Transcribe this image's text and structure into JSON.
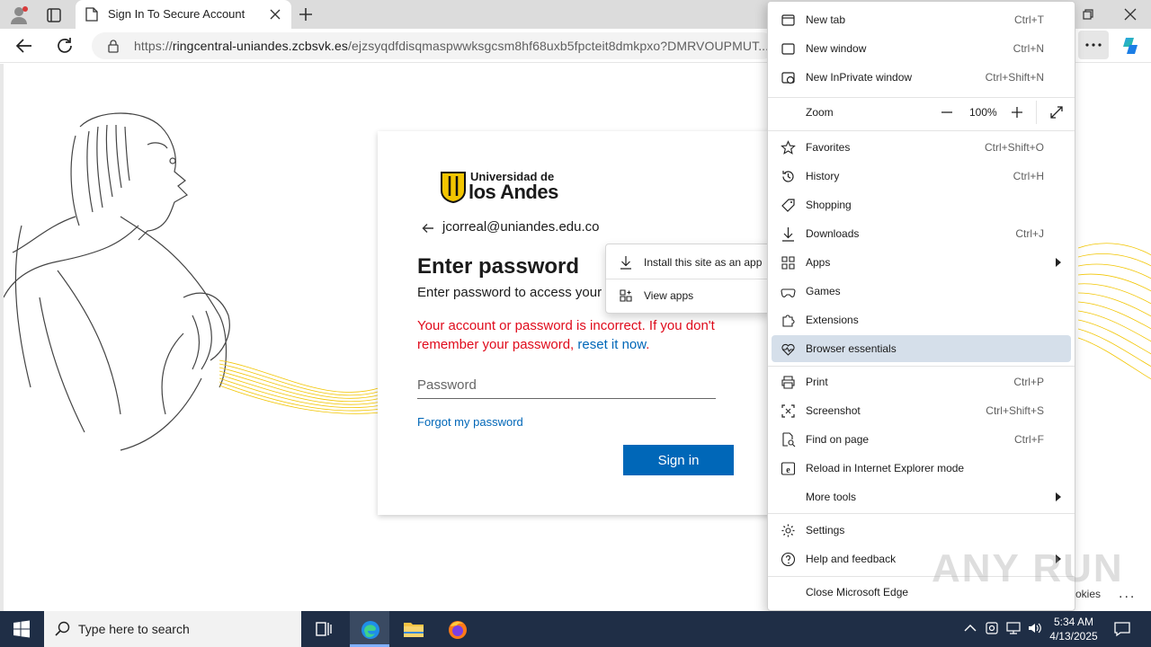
{
  "browser": {
    "tab_title": "Sign In To Secure Account",
    "url_prefix": "https://",
    "url_host": "ringcentral-uniandes.zcbsvk.es",
    "url_path": "/ejzsyqdfdisqmaspwwksgcsm8hf68uxb5fpcteit8dmkpxo?DMRVOUPMUT..."
  },
  "login": {
    "logo_line1": "Universidad de",
    "logo_line2": "los Andes",
    "email": "jcorreal@uniandes.edu.co",
    "heading": "Enter password",
    "subtitle": "Enter password to access your c",
    "error_text": "Your account or password is incorrect. If you don't remember your password,",
    "error_link": "reset it now",
    "error_end": ".",
    "password_placeholder": "Password",
    "forgot_link": "Forgot my password",
    "signin_button": "Sign in"
  },
  "apps_submenu": {
    "items": [
      {
        "label": "Install this site as an app",
        "icon": "download-icon"
      },
      {
        "label": "View apps",
        "icon": "apps-grid-icon"
      }
    ]
  },
  "menu": {
    "new_tab": {
      "label": "New tab",
      "shortcut": "Ctrl+T"
    },
    "new_window": {
      "label": "New window",
      "shortcut": "Ctrl+N"
    },
    "inprivate": {
      "label": "New InPrivate window",
      "shortcut": "Ctrl+Shift+N"
    },
    "zoom": {
      "label": "Zoom",
      "value": "100%"
    },
    "favorites": {
      "label": "Favorites",
      "shortcut": "Ctrl+Shift+O"
    },
    "history": {
      "label": "History",
      "shortcut": "Ctrl+H"
    },
    "shopping": {
      "label": "Shopping"
    },
    "downloads": {
      "label": "Downloads",
      "shortcut": "Ctrl+J"
    },
    "apps": {
      "label": "Apps"
    },
    "games": {
      "label": "Games"
    },
    "extensions": {
      "label": "Extensions"
    },
    "browser_essentials": {
      "label": "Browser essentials"
    },
    "print": {
      "label": "Print",
      "shortcut": "Ctrl+P"
    },
    "screenshot": {
      "label": "Screenshot",
      "shortcut": "Ctrl+Shift+S"
    },
    "find": {
      "label": "Find on page",
      "shortcut": "Ctrl+F"
    },
    "ie_mode": {
      "label": "Reload in Internet Explorer mode"
    },
    "more_tools": {
      "label": "More tools"
    },
    "settings": {
      "label": "Settings"
    },
    "help": {
      "label": "Help and feedback"
    },
    "close": {
      "label": "Close Microsoft Edge"
    }
  },
  "page_extras": {
    "cookies": "okies",
    "watermark": "ANY RUN"
  },
  "taskbar": {
    "search_placeholder": "Type here to search",
    "time": "5:34 AM",
    "date": "4/13/2025"
  },
  "colors": {
    "accent": "#0067b8",
    "error": "#e00b1c",
    "taskbar": "#1f2e46",
    "menu_highlight": "#d5dfea",
    "brand_yellow": "#f2c500"
  }
}
